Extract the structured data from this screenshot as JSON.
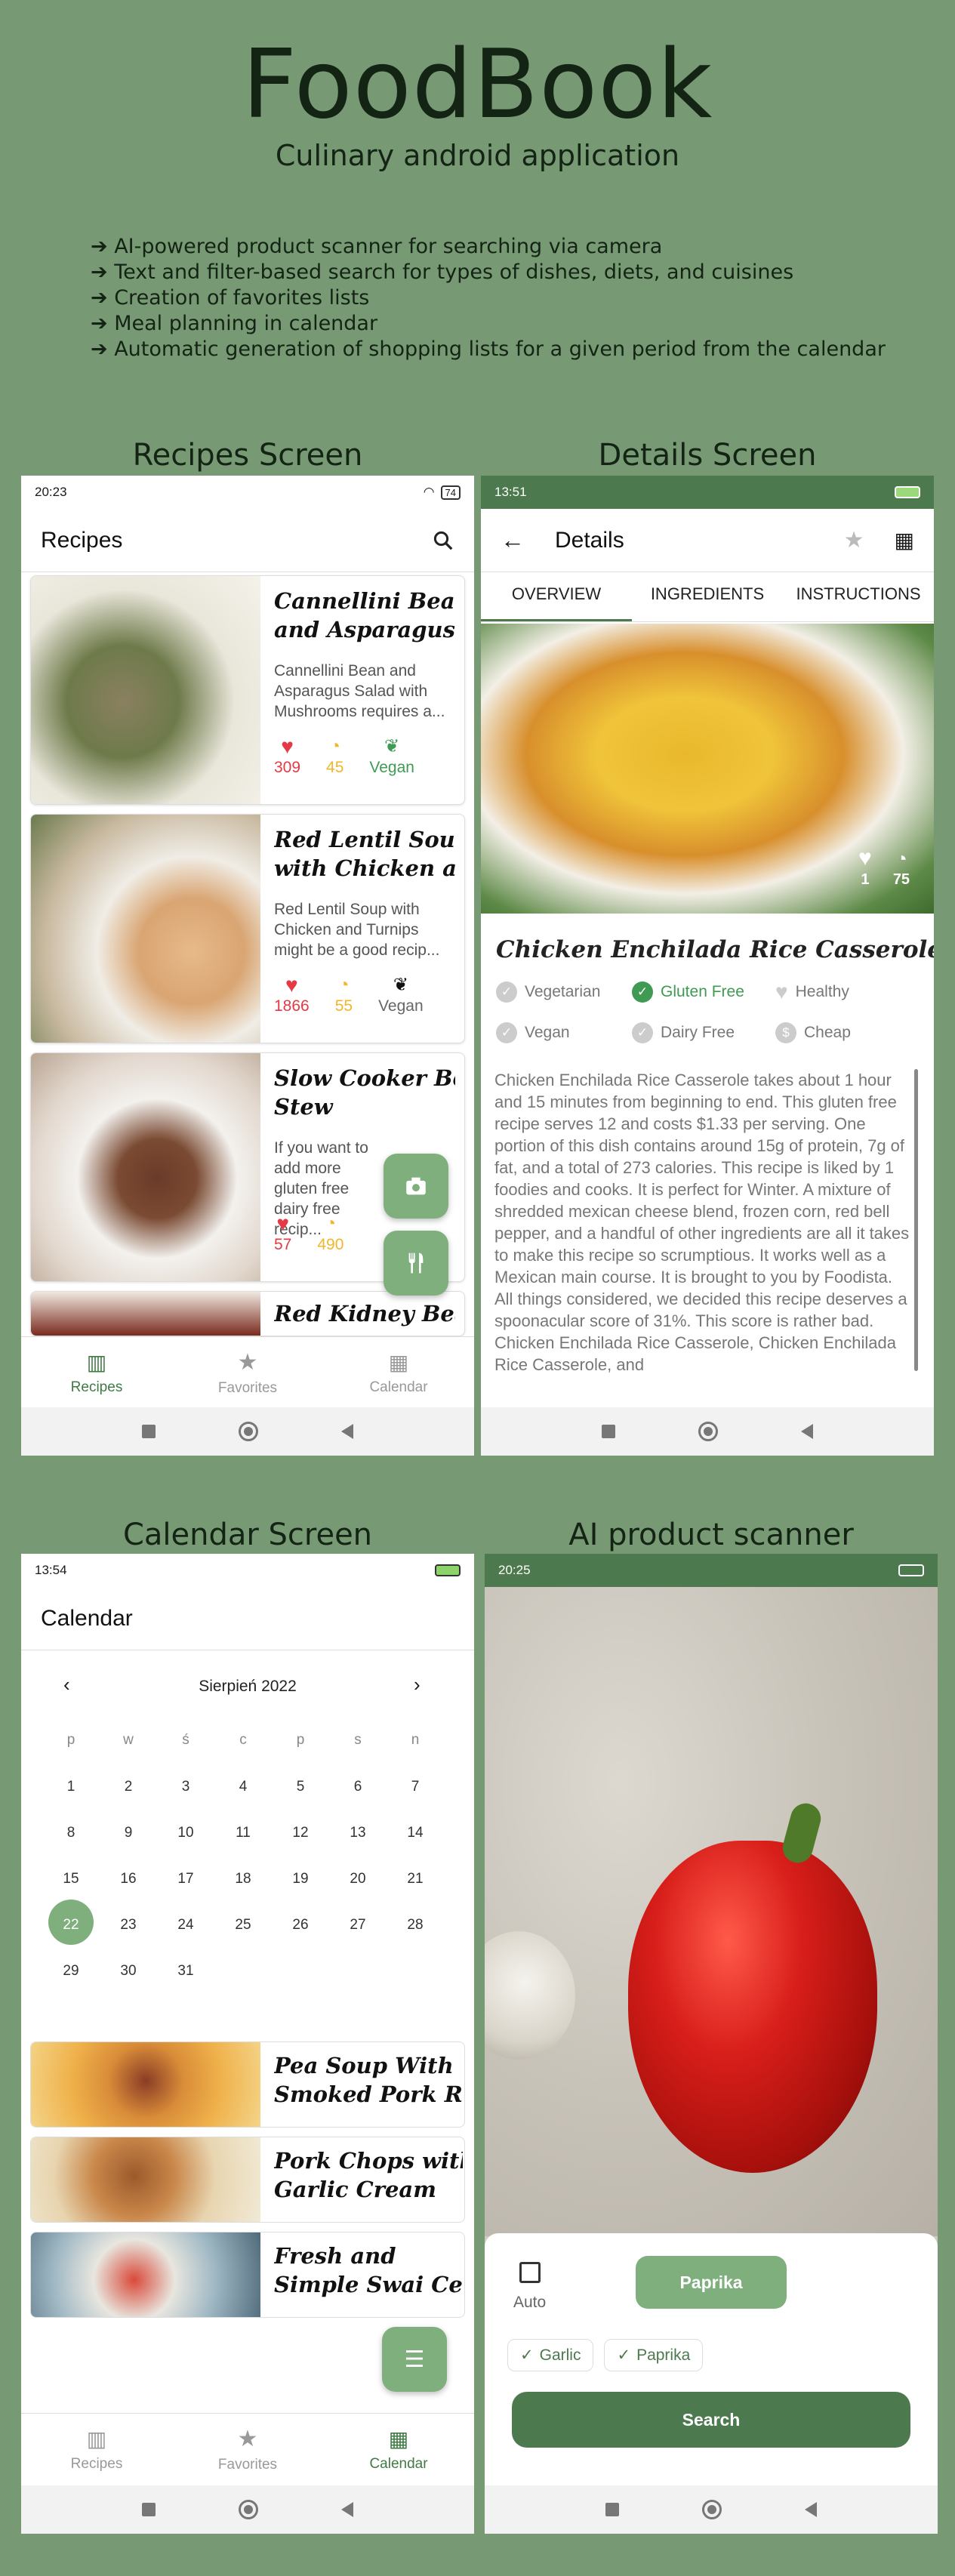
{
  "header": {
    "title": "FoodBook",
    "subtitle": "Culinary android application",
    "features": [
      "➔ AI-powered product scanner for searching via camera",
      "➔ Text and filter-based search for types of dishes, diets, and cuisines",
      "➔ Creation of favorites lists",
      "➔ Meal planning in calendar",
      "➔ Automatic generation of shopping lists for a given period from the calendar"
    ]
  },
  "sections": {
    "recipes": "Recipes Screen",
    "details": "Details Screen",
    "calendar": "Calendar Screen",
    "scanner": "AI product scanner"
  },
  "recipes_screen": {
    "time": "20:23",
    "battery": "74",
    "title": "Recipes",
    "cards": [
      {
        "title": "Cannellini Bean and Asparagus...",
        "title1": "Cannellini Bean",
        "title2": "and Asparagus...",
        "desc": "Cannellini Bean and Asparagus Salad with Mushrooms requires a...",
        "likes": "309",
        "time": "45",
        "diet": "Vegan"
      },
      {
        "title1": "Red Lentil Soup",
        "title2": "with Chicken a...",
        "desc": "Red Lentil Soup with Chicken and Turnips might be a good recip...",
        "likes": "1866",
        "time": "55",
        "diet": "Vegan"
      },
      {
        "title1": "Slow Cooker Beef",
        "title2": "Stew",
        "desc": "If you want to add more gluten free dairy free recip...",
        "likes": "57",
        "time": "490",
        "diet": ""
      },
      {
        "title1": "Red Kidney Bean",
        "title2": ""
      }
    ],
    "nav": [
      "Recipes",
      "Favorites",
      "Calendar"
    ]
  },
  "details_screen": {
    "time": "13:51",
    "title": "Details",
    "tabs": [
      "OVERVIEW",
      "INGREDIENTS",
      "INSTRUCTIONS"
    ],
    "likes": "1",
    "minutes": "75",
    "recipe_title": "Chicken Enchilada Rice Casserole",
    "tags": [
      "Vegetarian",
      "Gluten Free",
      "Healthy",
      "Vegan",
      "Dairy Free",
      "Cheap"
    ],
    "summary": "Chicken Enchilada Rice Casserole takes about 1 hour and 15 minutes from beginning to end. This gluten free recipe serves 12 and costs $1.33 per serving. One portion of this dish contains around 15g of protein, 7g of fat, and a total of 273 calories. This recipe is liked by 1 foodies and cooks. It is perfect for Winter. A mixture of shredded mexican cheese blend, frozen corn, red bell pepper, and a handful of other ingredients are all it takes to make this recipe so scrumptious. It works well as a Mexican main course. It is brought to you by Foodista. All things considered, we decided this recipe deserves a spoonacular score of 31%. This score is rather bad. Chicken Enchilada Rice Casserole, Chicken Enchilada Rice Casserole, and"
  },
  "calendar_screen": {
    "time": "13:54",
    "title": "Calendar",
    "month": "Sierpień 2022",
    "weekdays": [
      "p",
      "w",
      "ś",
      "c",
      "p",
      "s",
      "n"
    ],
    "days": [
      "1",
      "2",
      "3",
      "4",
      "5",
      "6",
      "7",
      "8",
      "9",
      "10",
      "11",
      "12",
      "13",
      "14",
      "15",
      "16",
      "17",
      "18",
      "19",
      "20",
      "21",
      "22",
      "23",
      "24",
      "25",
      "26",
      "27",
      "28",
      "29",
      "30",
      "31"
    ],
    "selected_day": "22",
    "meals": [
      {
        "title1": "Pea Soup With",
        "title2": "Smoked Pork R..."
      },
      {
        "title1": "Pork Chops with",
        "title2": "Garlic Cream"
      },
      {
        "title1": "Fresh and",
        "title2": "Simple Swai Ce..."
      }
    ],
    "nav": [
      "Recipes",
      "Favorites",
      "Calendar"
    ]
  },
  "scanner_screen": {
    "time": "20:25",
    "auto_label": "Auto",
    "detected": "Paprika",
    "chips": [
      "Garlic",
      "Paprika"
    ],
    "search_label": "Search"
  },
  "colors": {
    "background": "#779a74",
    "accent": "#7faf7d",
    "primary_dark": "#4c7a4e",
    "heart": "#e53a45",
    "timer": "#f2b62a",
    "green": "#3f9b53"
  }
}
